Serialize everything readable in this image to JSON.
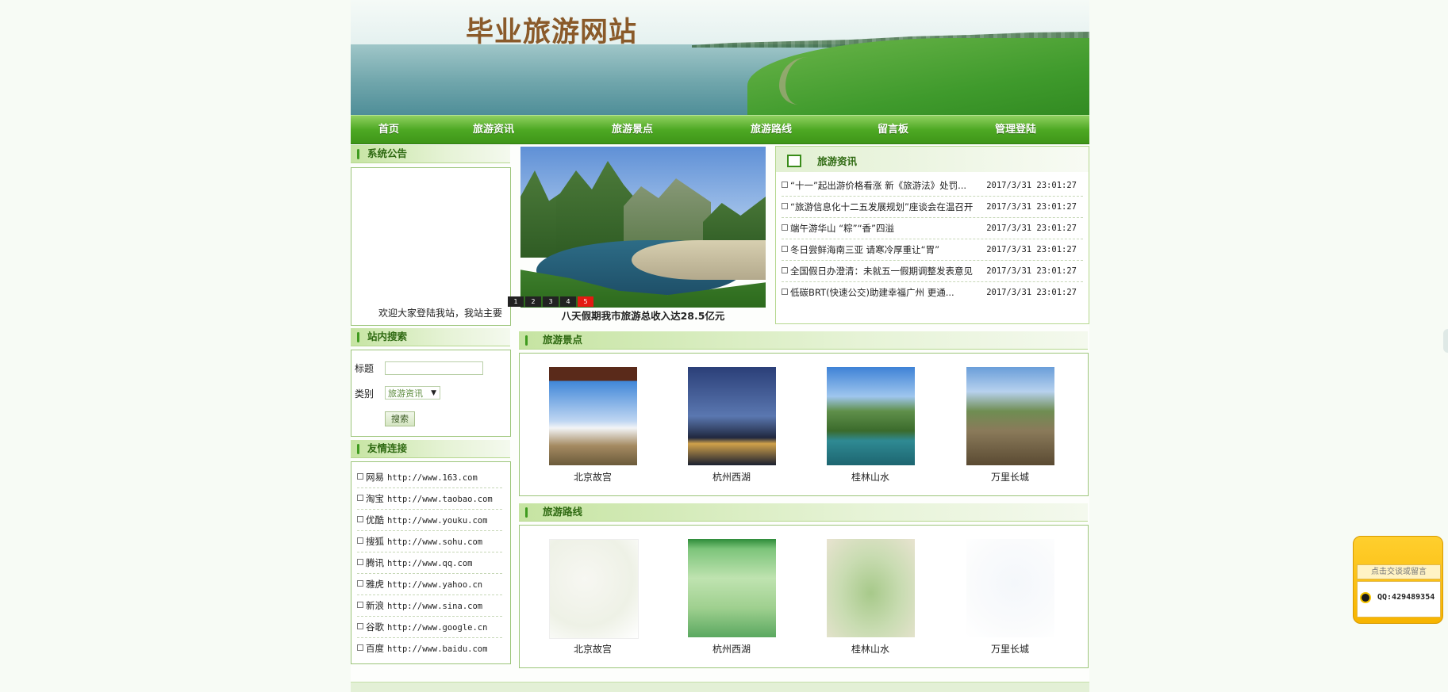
{
  "site": {
    "title": "毕业旅游网站"
  },
  "nav": [
    {
      "label": "首页"
    },
    {
      "label": "旅游资讯"
    },
    {
      "label": "旅游景点"
    },
    {
      "label": "旅游路线"
    },
    {
      "label": "留言板"
    },
    {
      "label": "管理登陆"
    }
  ],
  "notice": {
    "heading": "系统公告",
    "text": "欢迎大家登陆我站，我站主要"
  },
  "search": {
    "heading": "站内搜索",
    "title_label": "标题",
    "title_value": "",
    "category_label": "类别",
    "category_value": "旅游资讯",
    "button": "搜索"
  },
  "links": {
    "heading": "友情连接",
    "items": [
      {
        "name": "网易",
        "url": "http://www.163.com"
      },
      {
        "name": "淘宝",
        "url": "http://www.taobao.com"
      },
      {
        "name": "优酷",
        "url": "http://www.youku.com"
      },
      {
        "name": "搜狐",
        "url": "http://www.sohu.com"
      },
      {
        "name": "腾讯",
        "url": "http://www.qq.com"
      },
      {
        "name": "雅虎",
        "url": "http://www.yahoo.cn"
      },
      {
        "name": "新浪",
        "url": "http://www.sina.com"
      },
      {
        "name": "谷歌",
        "url": "http://www.google.cn"
      },
      {
        "name": "百度",
        "url": "http://www.baidu.com"
      }
    ]
  },
  "carousel": {
    "caption": "八天假期我市旅游总收入达28.5亿元",
    "dots": [
      "1",
      "2",
      "3",
      "4",
      "5"
    ],
    "active": 5
  },
  "news": {
    "heading": "旅游资讯",
    "items": [
      {
        "title": "“十一”起出游价格看涨 新《旅游法》处罚...",
        "date": "2017/3/31 23:01:27"
      },
      {
        "title": "“旅游信息化十二五发展规划”座谈会在温召开",
        "date": "2017/3/31 23:01:27"
      },
      {
        "title": "端午游华山 “粽”“香”四溢",
        "date": "2017/3/31 23:01:27"
      },
      {
        "title": "冬日尝鲜海南三亚 请寒冷厚重让“胃”",
        "date": "2017/3/31 23:01:27"
      },
      {
        "title": "全国假日办澄清：未就五一假期调整发表意见",
        "date": "2017/3/31 23:01:27"
      },
      {
        "title": "低碳BRT(快速公交)助建幸福广州 更通...",
        "date": "2017/3/31 23:01:27"
      }
    ]
  },
  "spots": {
    "heading": "旅游景点",
    "items": [
      {
        "name": "北京故宫"
      },
      {
        "name": "杭州西湖"
      },
      {
        "name": "桂林山水"
      },
      {
        "name": "万里长城"
      }
    ]
  },
  "routes": {
    "heading": "旅游路线",
    "items": [
      {
        "name": "北京故宫"
      },
      {
        "name": "杭州西湖"
      },
      {
        "name": "桂林山水"
      },
      {
        "name": "万里长城"
      }
    ]
  },
  "qq": {
    "title": "点击交谈或留言",
    "number": "QQ:429489354"
  },
  "colors": {
    "accent": "#4ea924",
    "heading": "#2f6a12",
    "border": "#9cc57a",
    "active_dot": "#e41a12"
  }
}
